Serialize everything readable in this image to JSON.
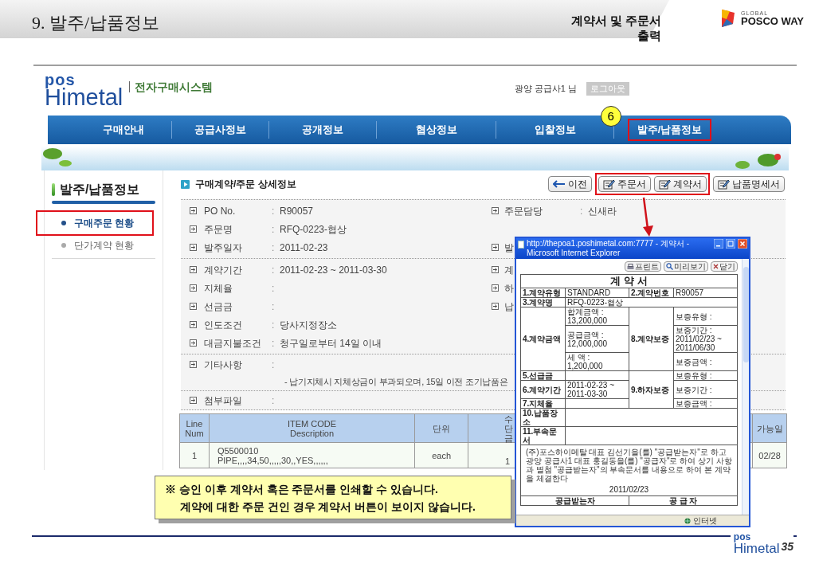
{
  "slide": {
    "title": "9. 발주/납품정보",
    "section_label": "계약서 및 주문서 출력",
    "brand_small": "GLOBAL",
    "brand_name": "POSCO WAY"
  },
  "site": {
    "logo_top": "pos",
    "logo_bottom": "Himetal",
    "system_name": "전자구매시스템",
    "user": "광양 공급사1 님",
    "logout": "로그아웃"
  },
  "nav": [
    {
      "label": "구매안내",
      "highlighted": false
    },
    {
      "label": "공급사정보",
      "highlighted": false
    },
    {
      "label": "공개정보",
      "highlighted": false
    },
    {
      "label": "협상정보",
      "highlighted": false
    },
    {
      "label": "입찰정보",
      "highlighted": false
    },
    {
      "label": "발주/납품정보",
      "highlighted": true,
      "step": "6"
    }
  ],
  "sidebar": {
    "title": "발주/납품정보",
    "items": [
      {
        "label": "구매주문 현황",
        "selected": true,
        "highlighted": true
      },
      {
        "label": "단가계약 현황",
        "selected": false,
        "highlighted": false
      }
    ]
  },
  "detail": {
    "title": "구매계약/주문 상세정보",
    "buttons": [
      {
        "label": "이전",
        "kind": "back",
        "highlighted": false
      },
      {
        "label": "주문서",
        "kind": "edit",
        "highlighted": true
      },
      {
        "label": "계약서",
        "kind": "edit",
        "highlighted": true
      },
      {
        "label": "납품명세서",
        "kind": "edit",
        "highlighted": false
      }
    ],
    "groups": [
      [
        {
          "label": "PO No.",
          "colon": ":",
          "value": "R90057",
          "right_label": "주문담당",
          "right_colon": ":",
          "right_value": "신새라"
        },
        {
          "label": "주문명",
          "colon": ":",
          "value": "RFQ-0223-협상"
        },
        {
          "label": "발주일자",
          "colon": ":",
          "value": "2011-02-23",
          "right_label": "발"
        }
      ],
      [
        {
          "label": "계약기간",
          "colon": ":",
          "value": "2011-02-23 ~ 2011-03-30",
          "right_label": "계"
        },
        {
          "label": "지체율",
          "colon": ":",
          "right_label": "하"
        },
        {
          "label": "선금금",
          "colon": ":",
          "right_label": "납"
        },
        {
          "label": "인도조건",
          "colon": ":",
          "value": "당사지정장소"
        },
        {
          "label": "대금지불조건",
          "colon": ":",
          "value": "청구일로부터 14일 이내"
        }
      ],
      [
        {
          "label": "기타사항",
          "colon": ":",
          "note": "- 납기지체시 지체상금이 부과되오며, 15일 이전 조기납품은"
        }
      ],
      [
        {
          "label": "첨부파일",
          "colon": ":"
        }
      ]
    ]
  },
  "table": {
    "columns": [
      {
        "lines": [
          "Line",
          "Num"
        ]
      },
      {
        "lines": [
          "ITEM CODE",
          "Description"
        ]
      },
      {
        "lines": [
          "단위"
        ]
      },
      {
        "lines": [
          "수",
          "단",
          "금"
        ]
      },
      {
        "lines": [
          "가능일"
        ]
      }
    ],
    "rows": [
      {
        "cells": [
          {
            "lines": [
              "1"
            ]
          },
          {
            "lines": [
              "Q5500010",
              "PIPE,,,,34,50,,,,,30,,YES,,,,,,"
            ]
          },
          {
            "lines": [
              "each"
            ]
          },
          {
            "lines": [
              "1"
            ]
          },
          {
            "lines": [
              "02/28"
            ]
          }
        ]
      }
    ]
  },
  "popup": {
    "title": "http://thepoa1.poshimetal.com:7777 - 계약서 - Microsoft Internet Explorer",
    "buttons": [
      {
        "label": "프린트",
        "kind": "print"
      },
      {
        "label": "미리보기",
        "kind": "preview"
      },
      {
        "label": "닫기",
        "kind": "close"
      }
    ],
    "document": {
      "title": "계 약 서",
      "row1": [
        {
          "label": "1.계약유형",
          "value": "STANDARD"
        },
        {
          "label": "2.계약번호",
          "value": "R90057"
        }
      ],
      "name": {
        "label": "3.계약명",
        "value": "RFQ-0223-협상"
      },
      "amount": {
        "label": "4.계약금액",
        "lines": [
          "합계금액 : 13,200,000",
          "공급금액 : 12,000,000",
          "세 액 : 1,200,000"
        ],
        "guarantee_label": "8.계약보증",
        "guarantee_lines": [
          "보증유형 :",
          "보증기간 : 2011/02/23 ~ 2011/06/30",
          "보증금액 :"
        ]
      },
      "lower": {
        "rows": [
          {
            "label": "5.선급금"
          },
          {
            "label": "6.계약기간",
            "value": "2011-02-23 ~ 2011-03-30"
          },
          {
            "label": "7.지체율"
          }
        ],
        "guarantee_label": "9.하자보증",
        "guarantee_lines": [
          "보증유형 :",
          "보증기간 :",
          "보증금액 :"
        ]
      },
      "extra_rows": [
        "10.납품장소",
        "11.부속문서"
      ],
      "statement": "(주)포스하이메탈 대표 김선기을(를) \"공급받는자\"로 하고 광양 공급사1 대표 홍길동을(를) \"공급자\"로 하여 상기 사항과 별첨 \"공급받는자\"의 부속문서를 내용으로 하여 본 계약을 체결한다",
      "date": "2011/02/23",
      "parties": [
        "공급받는자",
        "공 급 자"
      ]
    },
    "status": "인터넷"
  },
  "callout": {
    "lines": [
      "※ 승인 이후 계약서 혹은 주문서를 인쇄할 수 있습니다.",
      "계약에 대한 주문 건인 경우 계약서 버튼이 보이지 않습니다."
    ]
  },
  "footer": {
    "logo_top": "pos",
    "logo_bottom": "Himetal",
    "page": "35"
  }
}
